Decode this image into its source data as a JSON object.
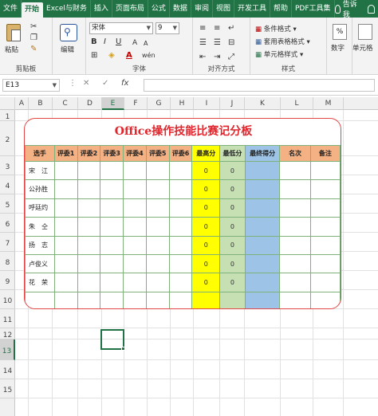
{
  "ribbon": {
    "tabs": [
      "文件",
      "开始",
      "Excel与财务",
      "插入",
      "页面布局",
      "公式",
      "数据",
      "审阅",
      "视图",
      "开发工具",
      "帮助",
      "PDF工具集"
    ],
    "active_tab": "开始",
    "tell_me": "告诉我",
    "clipboard": {
      "paste_label": "粘贴",
      "group_label": "剪贴板"
    },
    "editing": {
      "label": "编辑"
    },
    "font": {
      "font_name": "宋体",
      "font_size": "9",
      "bold": "B",
      "italic": "I",
      "underline": "U",
      "wen": "wén",
      "font_color_icon": "A",
      "grow": "A",
      "shrink": "A",
      "group_label": "字体"
    },
    "alignment": {
      "group_label": "对齐方式"
    },
    "styles": {
      "conditional": "条件格式",
      "table_format": "套用表格格式",
      "cell_styles": "单元格样式",
      "group_label": "样式"
    },
    "number": {
      "label": "数字"
    },
    "cells": {
      "label": "单元格"
    }
  },
  "formula_bar": {
    "name_box": "E13",
    "cancel_icon": "✕",
    "enter_icon": "✓",
    "fx_icon": "fx",
    "value": ""
  },
  "sheet": {
    "columns": [
      "A",
      "B",
      "C",
      "D",
      "E",
      "F",
      "G",
      "H",
      "I",
      "J",
      "K",
      "L",
      "M"
    ],
    "selected_column": "E",
    "rows": [
      "1",
      "2",
      "3",
      "4",
      "5",
      "6",
      "7",
      "8",
      "9",
      "10",
      "11",
      "12",
      "13",
      "14",
      "15"
    ],
    "selected_row": "13"
  },
  "board": {
    "title": "Office操作技能比赛记分板",
    "headers": [
      "选手",
      "评委1",
      "评委2",
      "评委3",
      "评委4",
      "评委5",
      "评委6",
      "最高分",
      "最低分",
      "最终得分",
      "名次",
      "备注"
    ],
    "rows": [
      {
        "name": "宋　江",
        "max": "0",
        "min": "0"
      },
      {
        "name": "公孙胜",
        "max": "0",
        "min": "0"
      },
      {
        "name": "呼廷灼",
        "max": "0",
        "min": "0"
      },
      {
        "name": "朱　仝",
        "max": "0",
        "min": "0"
      },
      {
        "name": "扬　志",
        "max": "0",
        "min": "0"
      },
      {
        "name": "卢俊义",
        "max": "0",
        "min": "0"
      },
      {
        "name": "花　荣",
        "max": "0",
        "min": "0"
      },
      {
        "name": "",
        "max": "",
        "min": ""
      }
    ],
    "colors": {
      "title": "#e0262d",
      "header_bg": "#f4b183",
      "max_col": "#ffff00",
      "min_col": "#c6e0b4",
      "final_col": "#9dc3e6",
      "border": "#e24646"
    }
  },
  "colors": {
    "brand": "#217346"
  }
}
